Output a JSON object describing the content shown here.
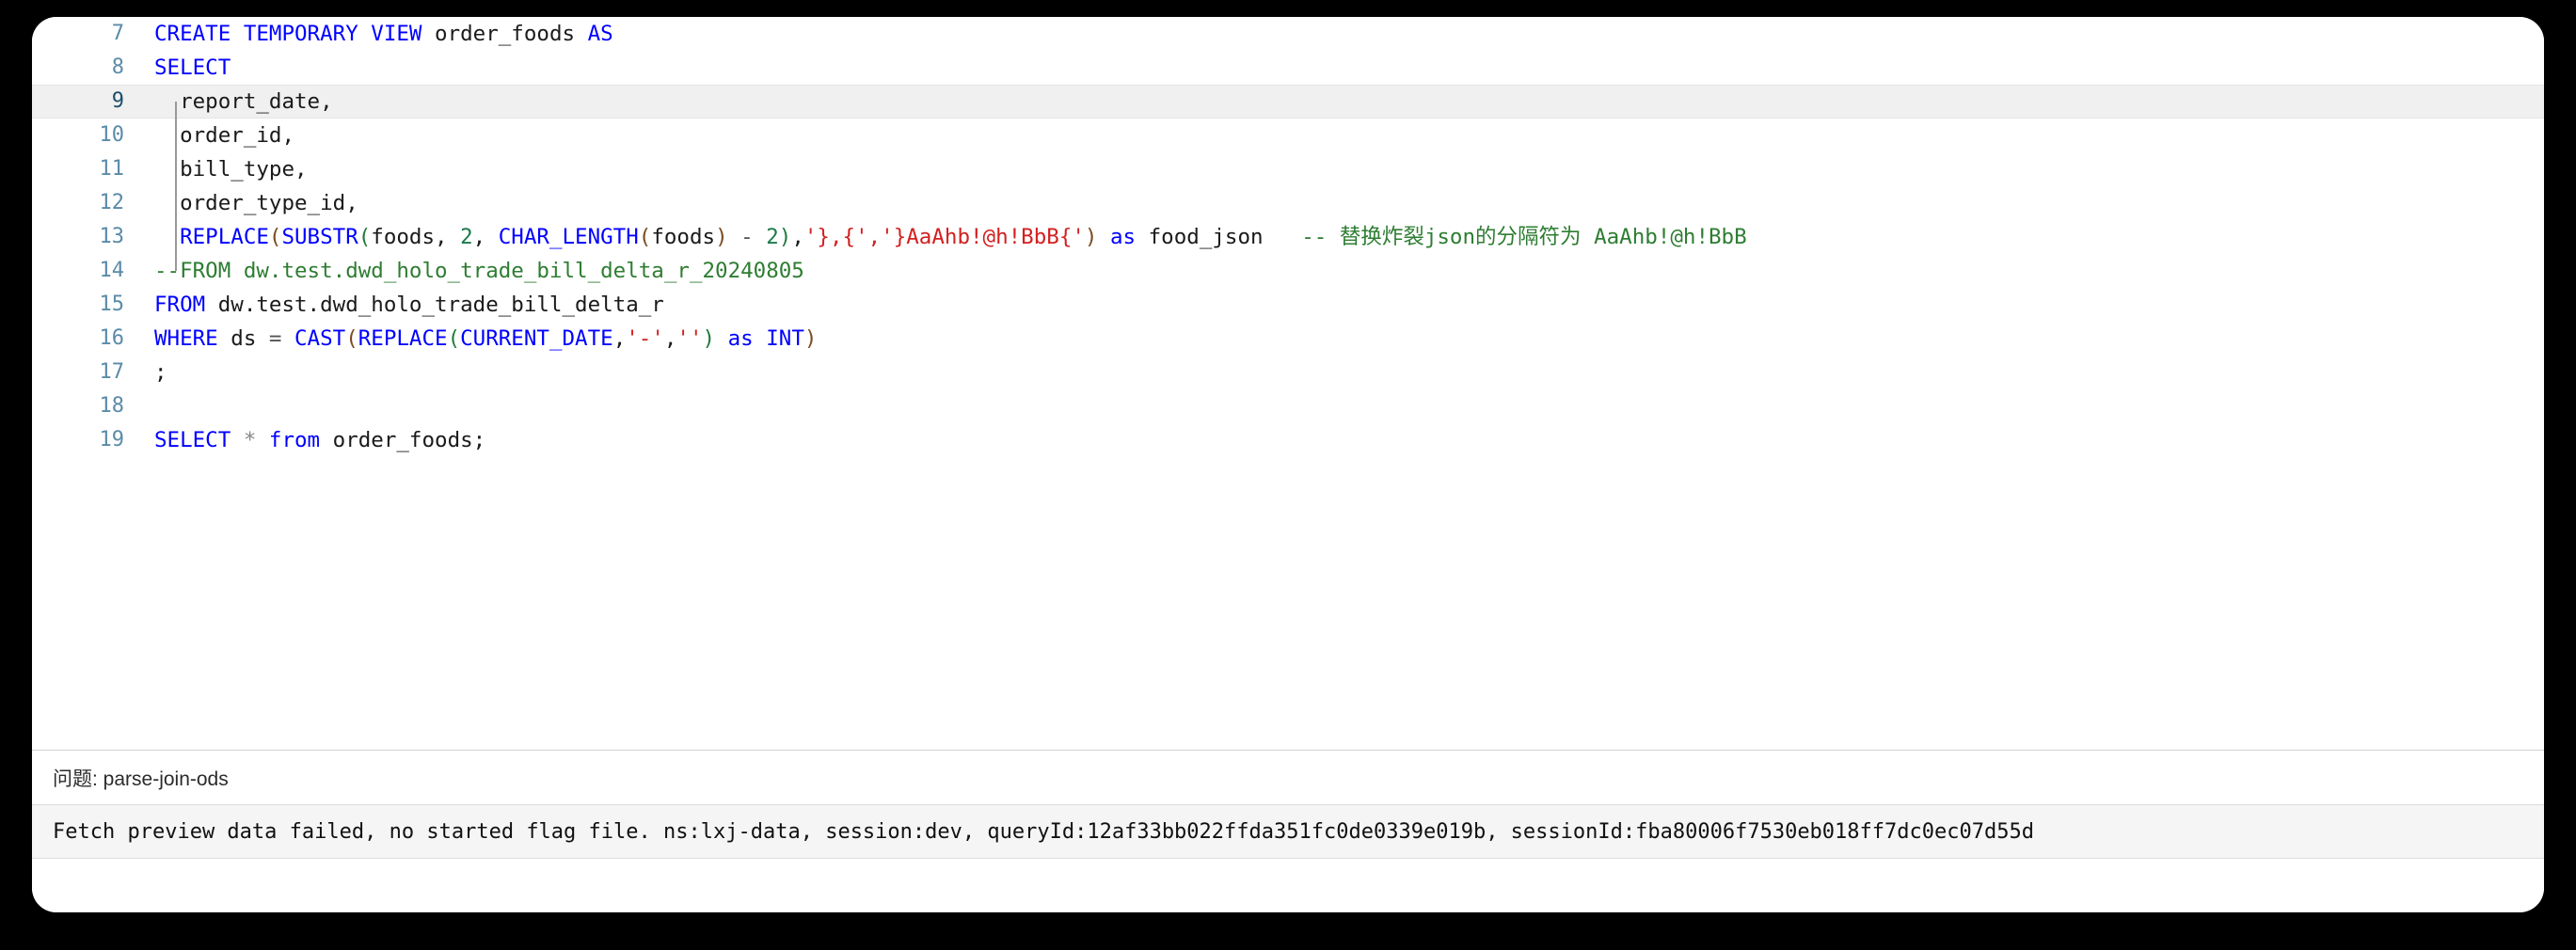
{
  "editor": {
    "language": "sql",
    "current_line": 9,
    "first_visible_line": 7,
    "lines": [
      {
        "num": "7",
        "current": false,
        "text": "CREATE TEMPORARY VIEW order_foods AS"
      },
      {
        "num": "8",
        "current": false,
        "text": "SELECT"
      },
      {
        "num": "9",
        "current": true,
        "text": "  report_date,"
      },
      {
        "num": "10",
        "current": false,
        "text": "  order_id,"
      },
      {
        "num": "11",
        "current": false,
        "text": "  bill_type,"
      },
      {
        "num": "12",
        "current": false,
        "text": "  order_type_id,"
      },
      {
        "num": "13",
        "current": false,
        "text": "  REPLACE(SUBSTR(foods, 2, CHAR_LENGTH(foods) - 2),'},{','}AaAhb!@h!BbB{') as food_json   -- 替换炸裂json的分隔符为 AaAhb!@h!BbB"
      },
      {
        "num": "14",
        "current": false,
        "text": "--FROM dw.test.dwd_holo_trade_bill_delta_r_20240805"
      },
      {
        "num": "15",
        "current": false,
        "text": "FROM dw.test.dwd_holo_trade_bill_delta_r"
      },
      {
        "num": "16",
        "current": false,
        "text": "WHERE ds = CAST(REPLACE(CURRENT_DATE,'-','') as INT)"
      },
      {
        "num": "17",
        "current": false,
        "text": ";"
      },
      {
        "num": "18",
        "current": false,
        "text": ""
      },
      {
        "num": "19",
        "current": false,
        "text": "SELECT * from order_foods;"
      }
    ],
    "tokens": {
      "l7": [
        {
          "t": "CREATE TEMPORARY VIEW",
          "c": "kw"
        },
        {
          "t": " order_foods ",
          "c": "plain"
        },
        {
          "t": "AS",
          "c": "kw"
        }
      ],
      "l8": [
        {
          "t": "SELECT",
          "c": "kw"
        }
      ],
      "l9": [
        {
          "t": "  report_date,",
          "c": "plain"
        }
      ],
      "l10": [
        {
          "t": "  order_id,",
          "c": "plain"
        }
      ],
      "l11": [
        {
          "t": "  bill_type,",
          "c": "plain"
        }
      ],
      "l12": [
        {
          "t": "  order_type_id,",
          "c": "plain"
        }
      ],
      "l13": [
        {
          "t": "  ",
          "c": "plain"
        },
        {
          "t": "REPLACE",
          "c": "fn"
        },
        {
          "t": "(",
          "c": "paren-b"
        },
        {
          "t": "SUBSTR",
          "c": "fn"
        },
        {
          "t": "(",
          "c": "paren-g"
        },
        {
          "t": "foods, ",
          "c": "plain"
        },
        {
          "t": "2",
          "c": "num"
        },
        {
          "t": ", ",
          "c": "plain"
        },
        {
          "t": "CHAR_LENGTH",
          "c": "fn"
        },
        {
          "t": "(",
          "c": "paren-b"
        },
        {
          "t": "foods",
          "c": "plain"
        },
        {
          "t": ")",
          "c": "paren-b"
        },
        {
          "t": " - ",
          "c": "op"
        },
        {
          "t": "2",
          "c": "num"
        },
        {
          "t": ")",
          "c": "paren-g"
        },
        {
          "t": ",",
          "c": "plain"
        },
        {
          "t": "'},{','}AaAhb!@h!BbB{'",
          "c": "str"
        },
        {
          "t": ")",
          "c": "paren-b"
        },
        {
          "t": " ",
          "c": "plain"
        },
        {
          "t": "as",
          "c": "kw"
        },
        {
          "t": " food_json   ",
          "c": "plain"
        },
        {
          "t": "-- 替换炸裂json的分隔符为 AaAhb!@h!BbB",
          "c": "cmt"
        }
      ],
      "l14": [
        {
          "t": "--FROM dw.test.dwd_holo_trade_bill_delta_r_20240805",
          "c": "cmt"
        }
      ],
      "l15": [
        {
          "t": "FROM",
          "c": "kw"
        },
        {
          "t": " dw.test.dwd_holo_trade_bill_delta_r",
          "c": "plain"
        }
      ],
      "l16": [
        {
          "t": "WHERE",
          "c": "kw"
        },
        {
          "t": " ds ",
          "c": "plain"
        },
        {
          "t": "=",
          "c": "op"
        },
        {
          "t": " ",
          "c": "plain"
        },
        {
          "t": "CAST",
          "c": "fn"
        },
        {
          "t": "(",
          "c": "paren-b"
        },
        {
          "t": "REPLACE",
          "c": "fn"
        },
        {
          "t": "(",
          "c": "paren-g"
        },
        {
          "t": "CURRENT_DATE",
          "c": "kw"
        },
        {
          "t": ",",
          "c": "plain"
        },
        {
          "t": "'-'",
          "c": "str"
        },
        {
          "t": ",",
          "c": "plain"
        },
        {
          "t": "''",
          "c": "str"
        },
        {
          "t": ")",
          "c": "paren-g"
        },
        {
          "t": " ",
          "c": "plain"
        },
        {
          "t": "as",
          "c": "kw"
        },
        {
          "t": " ",
          "c": "plain"
        },
        {
          "t": "INT",
          "c": "kw"
        },
        {
          "t": ")",
          "c": "paren-b"
        }
      ],
      "l17": [
        {
          "t": ";",
          "c": "plain"
        }
      ],
      "l18": [
        {
          "t": "",
          "c": "plain"
        }
      ],
      "l19": [
        {
          "t": "SELECT",
          "c": "kw"
        },
        {
          "t": " ",
          "c": "plain"
        },
        {
          "t": "*",
          "c": "star"
        },
        {
          "t": " ",
          "c": "plain"
        },
        {
          "t": "from",
          "c": "kw"
        },
        {
          "t": " order_foods;",
          "c": "plain"
        }
      ]
    }
  },
  "problem_bar": {
    "label": "问题: parse-join-ods"
  },
  "error_strip": {
    "message": "Fetch preview data failed, no started flag file. ns:lxj-data, session:dev, queryId:12af33bb022ffda351fc0de0339e019b, sessionId:fba80006f7530eb018ff7dc0ec07d55d"
  },
  "colors": {
    "keyword": "#0000ff",
    "string": "#d32020",
    "comment": "#2e7d32",
    "number": "#1a7a4a",
    "gutter": "#5a8ba8",
    "current_line_bg": "#f0f0f0",
    "error_strip_bg": "#f5f5f5",
    "window_bg": "#ffffff",
    "desktop_bg": "#000000"
  }
}
